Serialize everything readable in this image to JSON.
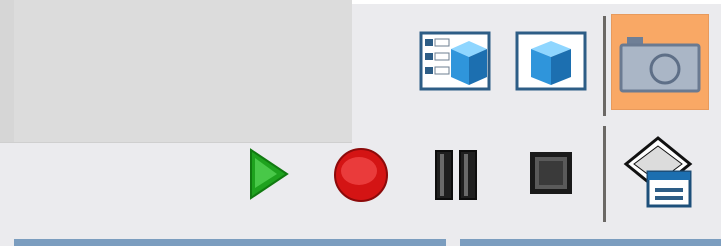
{
  "toolbar": {
    "row1": [
      {
        "icon": "list-cube-icon",
        "label": ""
      },
      {
        "icon": "cube-icon",
        "label": ""
      },
      {
        "icon": "camera-icon",
        "label": "",
        "active": true
      }
    ],
    "row2": [
      {
        "icon": "play-icon"
      },
      {
        "icon": "record-icon"
      },
      {
        "icon": "pause-icon"
      },
      {
        "icon": "stop-icon"
      },
      {
        "icon": "export-window-icon"
      }
    ]
  },
  "colors": {
    "background": "#ebebee",
    "active_button": "#f9a865",
    "play_green": "#1ea21e",
    "record_red": "#d41414",
    "cube_blue": "#3aa3e3"
  }
}
